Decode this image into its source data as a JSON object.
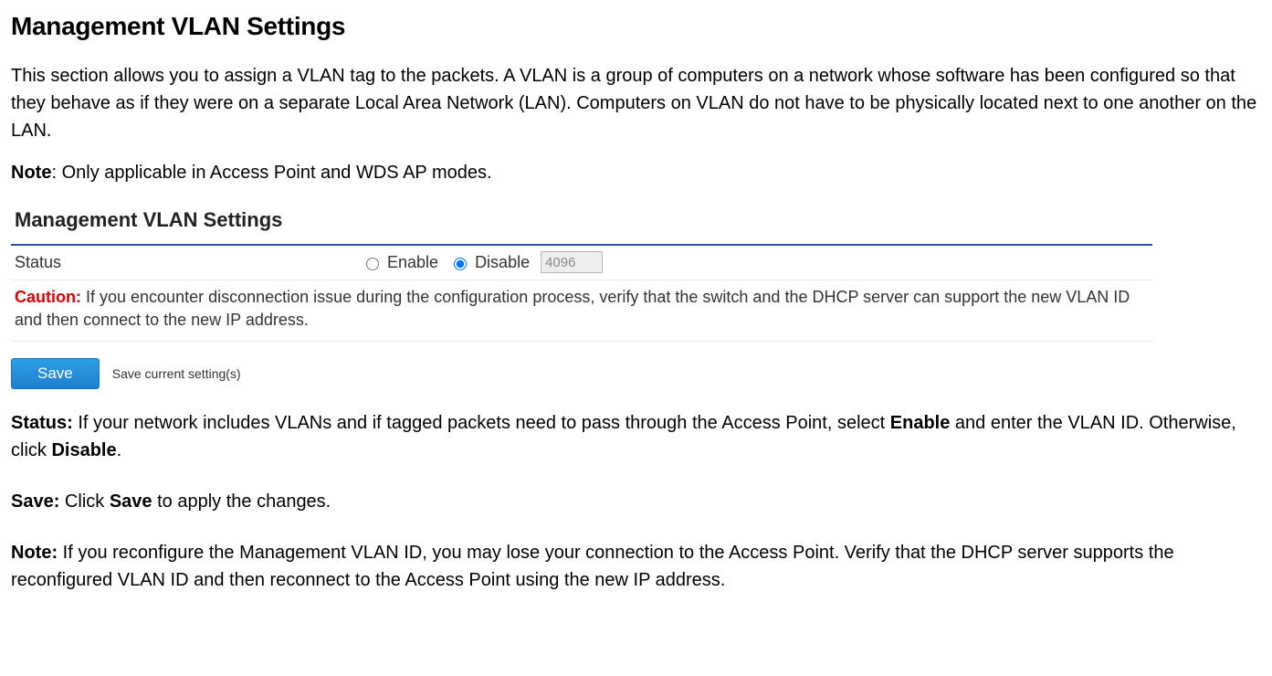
{
  "page": {
    "title": "Management VLAN Settings",
    "intro": "This section allows you to assign a VLAN tag to the packets. A VLAN is a group of computers on a network whose software has been configured so that they behave as if they were on a separate Local Area Network (LAN). Computers on VLAN do not have to be physically located next to one another on the LAN.",
    "note_label": "Note",
    "note_text": ": Only applicable in Access Point and WDS AP modes."
  },
  "screenshot": {
    "panel_title": "Management VLAN Settings",
    "status_label": "Status",
    "enable_label": "Enable",
    "disable_label": "Disable",
    "vlan_id_value": "4096",
    "caution_label": "Caution:",
    "caution_text": "If you encounter disconnection issue during the configuration process, verify that the switch and the DHCP server can support the new VLAN ID and then connect to the new IP address.",
    "save_button": "Save",
    "save_hint": "Save current setting(s)"
  },
  "descriptions": {
    "status_label": "Status:",
    "status_text_1": " If your network includes VLANs and if tagged packets need to pass through the Access Point, select ",
    "status_bold_1": "Enable",
    "status_text_2": " and enter the VLAN ID. Otherwise, click ",
    "status_bold_2": "Disable",
    "status_text_3": ".",
    "save_label": "Save:",
    "save_text_1": " Click ",
    "save_bold_1": "Save",
    "save_text_2": " to apply the changes.",
    "note2_label": "Note:",
    "note2_text": " If you reconfigure the Management VLAN ID, you may lose your connection to the Access Point. Verify that the DHCP server supports the reconfigured VLAN ID and then reconnect to the Access Point using the new IP address."
  }
}
